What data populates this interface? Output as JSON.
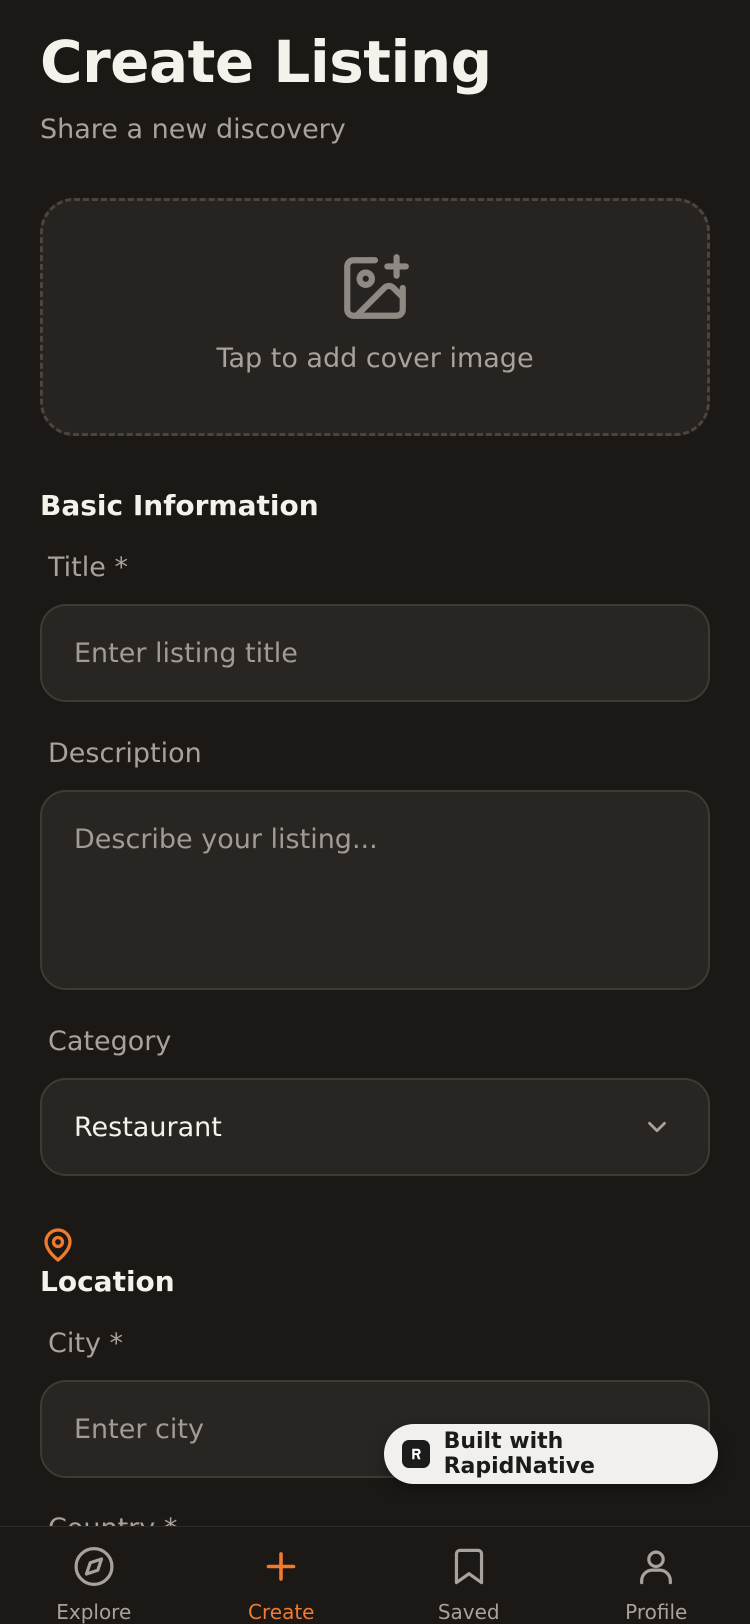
{
  "header": {
    "title": "Create Listing",
    "subtitle": "Share a new discovery"
  },
  "cover": {
    "icon": "image-plus-icon",
    "text": "Tap to add cover image"
  },
  "basic_info": {
    "section_title": "Basic Information",
    "title_label": "Title *",
    "title_placeholder": "Enter listing title",
    "description_label": "Description",
    "description_placeholder": "Describe your listing...",
    "category_label": "Category",
    "category_value": "Restaurant"
  },
  "location": {
    "icon": "map-pin-icon",
    "section_title": "Location",
    "city_label": "City *",
    "city_placeholder": "Enter city",
    "country_label": "Country *"
  },
  "badge": {
    "text": "Built with RapidNative"
  },
  "tabs": [
    {
      "label": "Explore",
      "icon": "compass-icon",
      "active": false
    },
    {
      "label": "Create",
      "icon": "plus-icon",
      "active": true
    },
    {
      "label": "Saved",
      "icon": "bookmark-icon",
      "active": false
    },
    {
      "label": "Profile",
      "icon": "user-icon",
      "active": false
    }
  ],
  "colors": {
    "background": "#1c1816",
    "accent": "#f07a2e",
    "field_background": "#282522",
    "muted_text": "#a7a29b"
  }
}
